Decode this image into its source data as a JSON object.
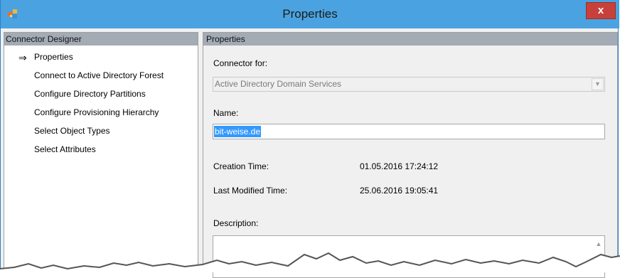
{
  "window": {
    "title": "Properties",
    "close_glyph": "x"
  },
  "left_pane": {
    "header": "Connector Designer",
    "current_indicator": "⇒",
    "items": [
      {
        "label": "Properties",
        "current": true
      },
      {
        "label": "Connect to Active Directory Forest"
      },
      {
        "label": "Configure Directory Partitions"
      },
      {
        "label": "Configure Provisioning Hierarchy"
      },
      {
        "label": "Select Object Types"
      },
      {
        "label": "Select Attributes"
      }
    ]
  },
  "right_pane": {
    "header": "Properties",
    "connector_for_label": "Connector for:",
    "connector_for_value": "Active Directory Domain Services",
    "name_label": "Name:",
    "name_value": "bit-weise.de",
    "creation_time_label": "Creation Time:",
    "creation_time_value": "01.05.2016 17:24:12",
    "last_modified_label": "Last Modified Time:",
    "last_modified_value": "25.06.2016 19:05:41",
    "description_label": "Description:"
  },
  "colors": {
    "titlebar": "#4aa3e0",
    "close_button": "#c7413a",
    "pane_header": "#a3abb5",
    "selection": "#3399ff"
  },
  "icons": [
    "app-icon",
    "close-icon",
    "arrow-right-icon",
    "chevron-down-icon",
    "scroll-up-icon"
  ]
}
